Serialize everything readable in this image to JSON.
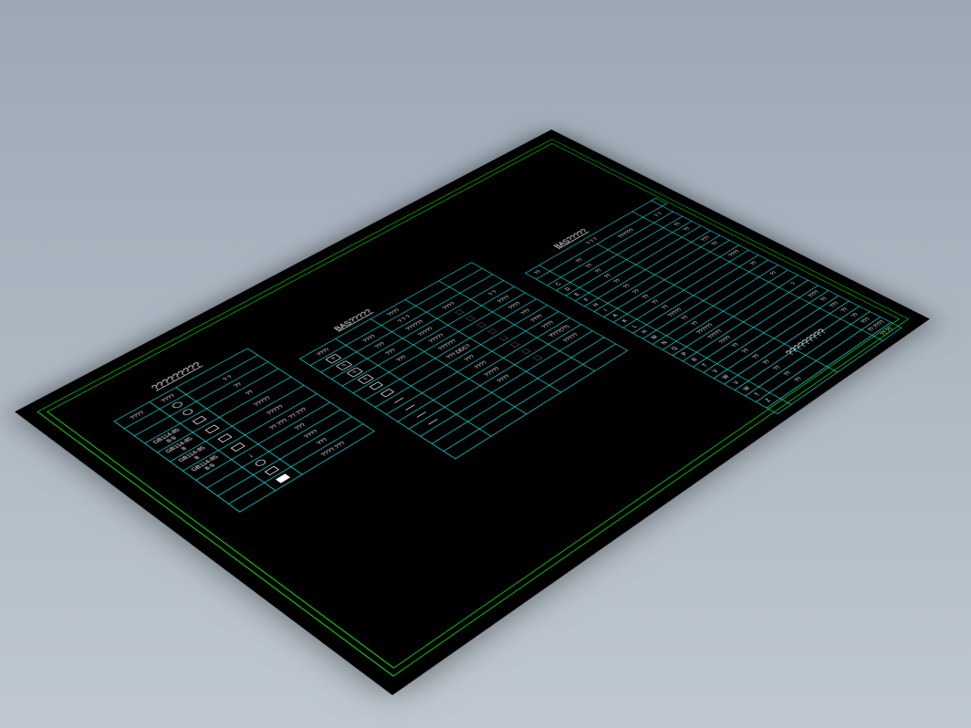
{
  "titles": {
    "main": "?????????",
    "table2": "BAS?????",
    "table3": "BAS?????",
    "footer": "?????????"
  },
  "table1": {
    "headers": [
      "????",
      "????",
      ""
    ],
    "rows": [
      [
        "",
        "sym:circ",
        "?   ?"
      ],
      [
        "",
        "sym:circ2",
        "??"
      ],
      [
        "GB114-85\\n8-9",
        "sym:rect",
        "??"
      ],
      [
        "GB114-85\\n8",
        "sym:rect",
        "?????"
      ],
      [
        "GB114-85\\n8",
        "sym:rect",
        "?????"
      ],
      [
        "GB114-85\\n8-9",
        "sym:rect",
        "??.???. ??.???"
      ],
      [
        "",
        "sym:arrow",
        "???"
      ],
      [
        "",
        "sym:circ",
        "????"
      ],
      [
        "",
        "sym:rect2",
        "???"
      ],
      [
        "",
        "sym:box",
        "????.???"
      ]
    ]
  },
  "table2": {
    "headers": [
      "????",
      "",
      "????",
      "",
      ""
    ],
    "rows": [
      [
        "sym:badge",
        "????",
        "?  ?  ?",
        "",
        ""
      ],
      [
        "sym:badge",
        "???",
        "??????",
        "????",
        ""
      ],
      [
        "sym:badge",
        "???",
        "?????",
        "sym:fig",
        "?   ?"
      ],
      [
        "sym:badge",
        "???",
        "?????",
        "sym:fig",
        "????"
      ],
      [
        "sym:rect",
        "",
        "??????",
        "sym:fig",
        "????"
      ],
      [
        "sym:rect",
        "",
        "???.DDC?",
        "sym:fig",
        "???"
      ],
      [
        "sym:line",
        "",
        "???",
        "sym:fig",
        "????"
      ],
      [
        "sym:line",
        "",
        "????",
        "sym:fig",
        "????"
      ],
      [
        "sym:line",
        "",
        "?????",
        "sym:fig",
        "????(??)"
      ],
      [
        "sym:line",
        "",
        "????",
        "sym:fig",
        "?????"
      ],
      [
        "",
        "",
        "",
        "",
        ""
      ],
      [
        "",
        "",
        "",
        "",
        ""
      ],
      [
        "",
        "",
        "",
        "",
        ""
      ]
    ]
  },
  "table3": {
    "headers": [
      "??",
      "?  ?  ?",
      "",
      ""
    ],
    "subheaders": [
      "",
      "??",
      "??????",
      "?  ?"
    ],
    "rows": [
      [
        "C",
        "??",
        "",
        ""
      ],
      [
        "D",
        "??",
        "",
        "??"
      ],
      [
        "E",
        "??",
        "",
        "??"
      ],
      [
        "F",
        "??",
        "",
        ""
      ],
      [
        "H",
        "??",
        "",
        "???"
      ],
      [
        "I",
        "??",
        "",
        "??"
      ],
      [
        "A",
        "??",
        "",
        ""
      ],
      [
        "K",
        "??",
        "",
        "????"
      ],
      [
        "L",
        "??",
        "",
        ""
      ],
      [
        "H",
        "?????",
        "",
        "??"
      ],
      [
        "M",
        "??",
        "",
        ""
      ],
      [
        "N",
        "??",
        "",
        "??"
      ],
      [
        "Q",
        "??????",
        "",
        ""
      ],
      [
        "P",
        "?????",
        "",
        "?"
      ],
      [
        "R",
        "????",
        "",
        ""
      ],
      [
        "T",
        "??",
        "",
        "????"
      ],
      [
        "V",
        "??",
        "",
        "??"
      ],
      [
        "W",
        "??",
        "",
        "???"
      ],
      [
        "V",
        "??",
        "",
        "??"
      ],
      [
        "W",
        "??",
        "",
        "??"
      ],
      [
        "T",
        "??",
        "",
        "???"
      ],
      [
        "Z",
        "??",
        "",
        "??.????"
      ],
      [
        "",
        "",
        "",
        "??.??"
      ]
    ]
  }
}
